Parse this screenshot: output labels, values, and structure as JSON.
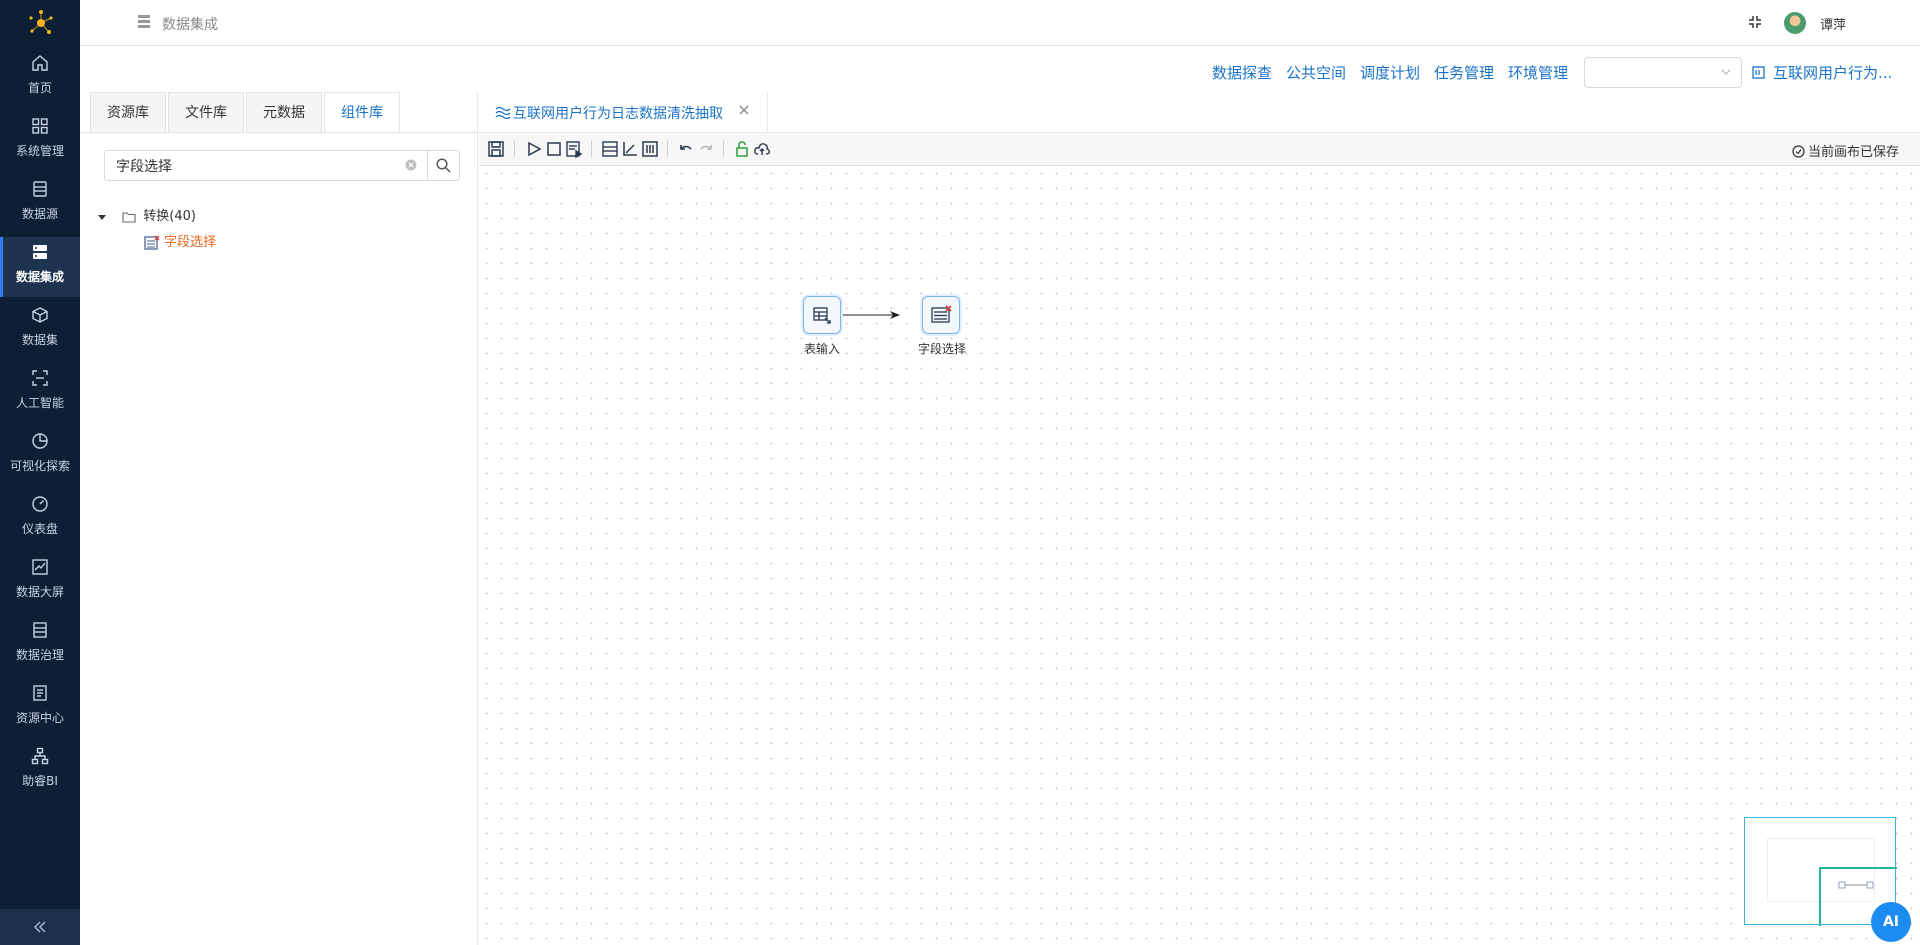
{
  "sidebar": {
    "items": [
      {
        "label": "首页",
        "icon": "home-icon"
      },
      {
        "label": "系统管理",
        "icon": "grid-icon"
      },
      {
        "label": "数据源",
        "icon": "database-icon"
      },
      {
        "label": "数据集成",
        "icon": "server-icon",
        "active": true
      },
      {
        "label": "数据集",
        "icon": "cube-icon"
      },
      {
        "label": "人工智能",
        "icon": "scan-icon"
      },
      {
        "label": "可视化探索",
        "icon": "pie-icon"
      },
      {
        "label": "仪表盘",
        "icon": "gauge-icon"
      },
      {
        "label": "数据大屏",
        "icon": "line-chart-icon"
      },
      {
        "label": "数据治理",
        "icon": "list-icon"
      },
      {
        "label": "资源中心",
        "icon": "doc-icon"
      },
      {
        "label": "助睿BI",
        "icon": "org-icon"
      }
    ],
    "collapse_icon": "double-chevron-left-icon"
  },
  "header": {
    "breadcrumb": "数据集成",
    "username": "谭萍"
  },
  "subheader": {
    "menu": [
      "数据探查",
      "公共空间",
      "调度计划",
      "任务管理",
      "环境管理"
    ],
    "select_value": "",
    "project": "互联网用户行为..."
  },
  "left_panel": {
    "tabs": [
      "资源库",
      "文件库",
      "元数据",
      "组件库"
    ],
    "active_tab": "组件库",
    "search": {
      "value": "字段选择",
      "placeholder": ""
    },
    "tree": {
      "folder": "转换(40)",
      "leaf": "字段选择"
    }
  },
  "editor": {
    "tab_title": "互联网用户行为日志数据清洗抽取",
    "saved_status": "当前画布已保存",
    "nodes": [
      {
        "label": "表输入"
      },
      {
        "label": "字段选择"
      }
    ]
  },
  "ai_button": "AI",
  "colors": {
    "accent": "#1a73c9",
    "sidebar": "#0d1f35",
    "highlight": "#e8661f"
  }
}
